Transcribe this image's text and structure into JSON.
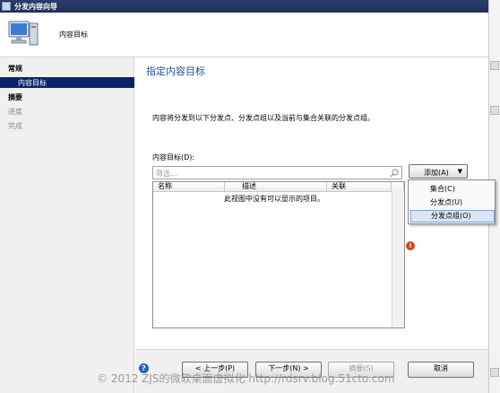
{
  "window": {
    "title": "分发内容向导"
  },
  "header": {
    "title": "内容目标"
  },
  "nav": {
    "items": [
      {
        "label": "常规"
      },
      {
        "label": "内容目标"
      },
      {
        "label": "摘要"
      },
      {
        "label": "进度"
      },
      {
        "label": "完成"
      }
    ]
  },
  "main": {
    "title": "指定内容目标",
    "description": "内容将分发到以下分发点、分发点组以及当前与集合关联的分发点组。",
    "target_label": "内容目标(D):",
    "filter_placeholder": "筛选...",
    "add_button": "添加(A)",
    "columns": [
      "名称",
      "描述",
      "关联"
    ],
    "empty_message": "此视图中没有可以显示的项目。"
  },
  "menu": {
    "items": [
      {
        "label": "集合(C)"
      },
      {
        "label": "分发点(U)"
      },
      {
        "label": "分发点组(O)"
      }
    ]
  },
  "buttons": {
    "prev": "< 上一步(P)",
    "next": "下一步(N) >",
    "summary": "摘要(S)",
    "cancel": "取消"
  },
  "watermark": "© 2012 ZJS的微软桌面虚拟化 http://rdsrv.blog.51cto.com",
  "colors": {
    "selection": "#0a246a",
    "title_blue": "#1b4f9a",
    "warning": "#d0451e"
  }
}
